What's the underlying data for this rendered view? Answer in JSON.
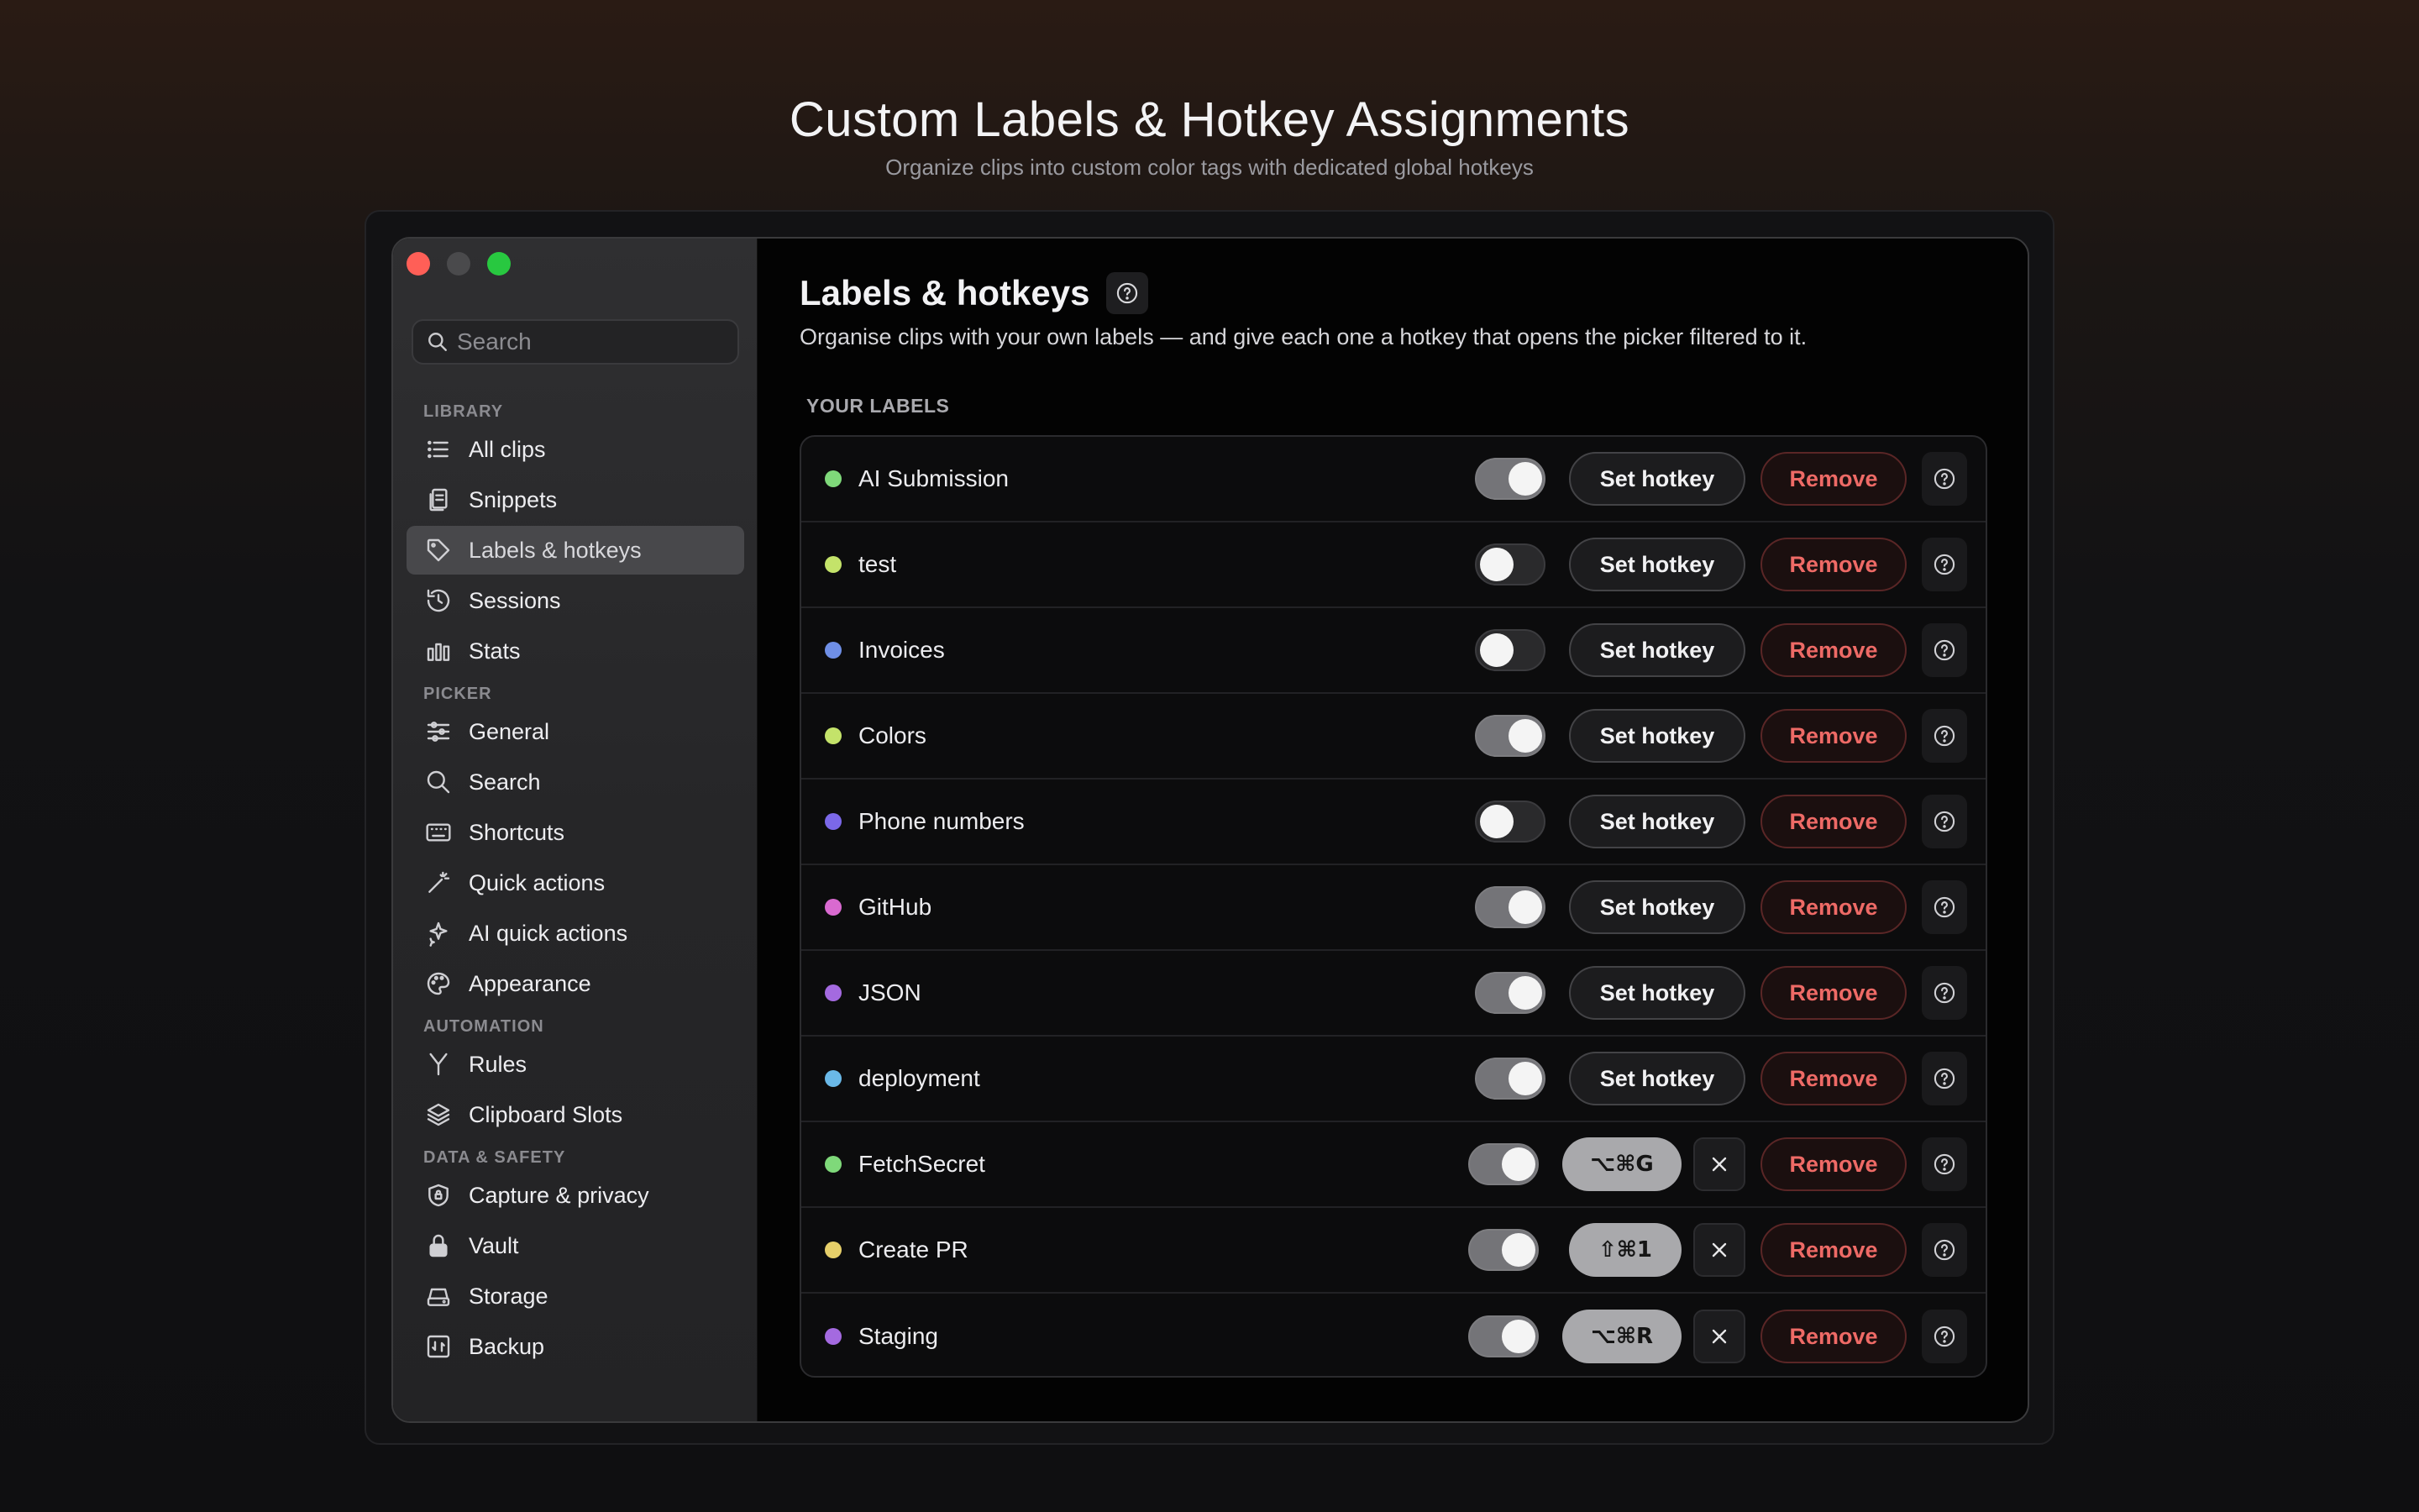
{
  "hero": {
    "title": "Custom Labels & Hotkey Assignments",
    "subtitle": "Organize clips into custom color tags with dedicated global hotkeys"
  },
  "sidebar": {
    "search_placeholder": "Search",
    "sections": [
      {
        "heading": "LIBRARY",
        "items": [
          {
            "label": "All clips",
            "icon": "list-icon"
          },
          {
            "label": "Snippets",
            "icon": "document-icon"
          },
          {
            "label": "Labels & hotkeys",
            "icon": "tag-icon",
            "active": true
          },
          {
            "label": "Sessions",
            "icon": "history-icon"
          },
          {
            "label": "Stats",
            "icon": "bar-chart-icon"
          }
        ]
      },
      {
        "heading": "PICKER",
        "items": [
          {
            "label": "General",
            "icon": "sliders-icon"
          },
          {
            "label": "Search",
            "icon": "search-icon"
          },
          {
            "label": "Shortcuts",
            "icon": "keyboard-icon"
          },
          {
            "label": "Quick actions",
            "icon": "wand-icon"
          },
          {
            "label": "AI quick actions",
            "icon": "sparkle-icon"
          },
          {
            "label": "Appearance",
            "icon": "palette-icon"
          }
        ]
      },
      {
        "heading": "AUTOMATION",
        "items": [
          {
            "label": "Rules",
            "icon": "branch-icon"
          },
          {
            "label": "Clipboard Slots",
            "icon": "layers-icon"
          }
        ]
      },
      {
        "heading": "DATA & SAFETY",
        "items": [
          {
            "label": "Capture & privacy",
            "icon": "shield-icon"
          },
          {
            "label": "Vault",
            "icon": "lock-icon"
          },
          {
            "label": "Storage",
            "icon": "drive-icon"
          },
          {
            "label": "Backup",
            "icon": "backup-icon"
          }
        ]
      }
    ]
  },
  "main": {
    "title": "Labels & hotkeys",
    "subtitle": "Organise clips with your own labels — and give each one a hotkey that opens the picker filtered to it.",
    "section_label": "YOUR LABELS",
    "set_hotkey_label": "Set hotkey",
    "remove_label": "Remove",
    "labels": [
      {
        "name": "AI Submission",
        "color": "#7fd97a",
        "enabled": true,
        "hotkey": ""
      },
      {
        "name": "test",
        "color": "#c4e36a",
        "enabled": false,
        "hotkey": ""
      },
      {
        "name": "Invoices",
        "color": "#6f8fe6",
        "enabled": false,
        "hotkey": ""
      },
      {
        "name": "Colors",
        "color": "#c4e36a",
        "enabled": true,
        "hotkey": ""
      },
      {
        "name": "Phone numbers",
        "color": "#7b68e8",
        "enabled": false,
        "hotkey": ""
      },
      {
        "name": "GitHub",
        "color": "#d96ad0",
        "enabled": true,
        "hotkey": ""
      },
      {
        "name": "JSON",
        "color": "#a46ae0",
        "enabled": true,
        "hotkey": ""
      },
      {
        "name": "deployment",
        "color": "#6ab9e8",
        "enabled": true,
        "hotkey": ""
      },
      {
        "name": "FetchSecret",
        "color": "#7fd97a",
        "enabled": true,
        "hotkey": "⌥⌘G"
      },
      {
        "name": "Create PR",
        "color": "#e6cf6a",
        "enabled": true,
        "hotkey": "⇧⌘1"
      },
      {
        "name": "Staging",
        "color": "#a46ae0",
        "enabled": true,
        "hotkey": "⌥⌘R"
      }
    ]
  }
}
